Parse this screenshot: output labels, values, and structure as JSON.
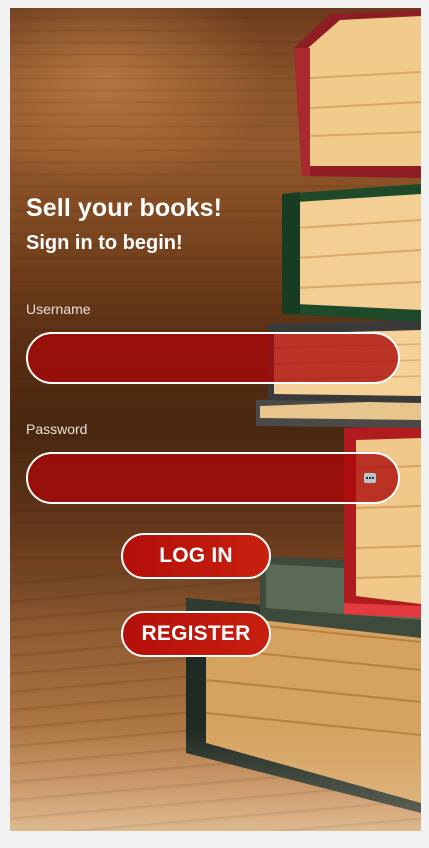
{
  "hero": {
    "headline": "Sell your books!",
    "subheadline": "Sign in to begin!"
  },
  "form": {
    "username_label": "Username",
    "username_value": "",
    "password_label": "Password",
    "password_value": "",
    "login_label": "LOG IN",
    "register_label": "REGISTER"
  },
  "icons": {
    "password_manager": "password-key-icon"
  },
  "colors": {
    "field_fill": "#aa0808",
    "button_fill": "#c01a0c",
    "border": "#ffffff",
    "text": "#ffffff"
  }
}
